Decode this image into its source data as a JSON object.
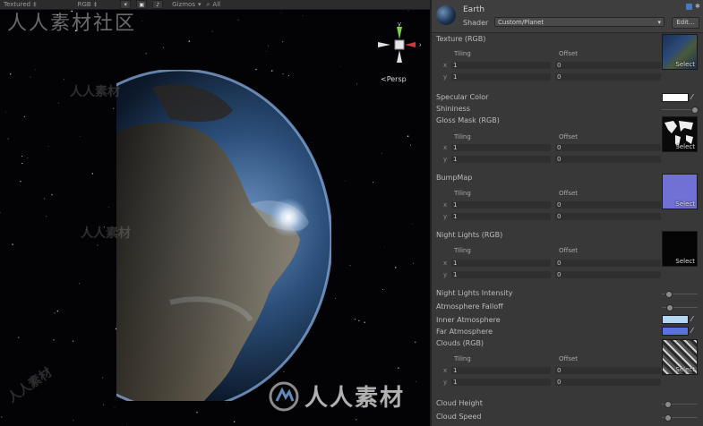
{
  "toolbar": {
    "draw_mode": "Textured",
    "render_mode": "RGB",
    "gizmos": "Gizmos",
    "search": "All"
  },
  "scene": {
    "watermark_top": "人人素材社区",
    "logo_text": "人人素材",
    "side_watermark": "人人素材",
    "persp_label": "Persp",
    "gizmo_axes": {
      "x": "x",
      "y": "y"
    }
  },
  "inspector": {
    "material_name": "Earth",
    "shader_label": "Shader",
    "shader_value": "Custom/Planet",
    "edit_button": "Edit...",
    "tiling_header": "Tiling",
    "offset_header": "Offset",
    "select_label": "Select",
    "axis_x": "x",
    "axis_y": "y",
    "texture": {
      "label": "Texture (RGB)",
      "tx": "1",
      "ty": "1",
      "ox": "0",
      "oy": "0"
    },
    "specular_color": {
      "label": "Specular Color",
      "color": "#ffffff"
    },
    "shininess": {
      "label": "Shininess",
      "value": 0.98
    },
    "gloss_mask": {
      "label": "Gloss Mask (RGB)",
      "tx": "1",
      "ty": "1",
      "ox": "0",
      "oy": "0"
    },
    "bump_map": {
      "label": "BumpMap",
      "tx": "1",
      "ty": "1",
      "ox": "0",
      "oy": "0"
    },
    "night_lights": {
      "label": "Night Lights (RGB)",
      "tx": "1",
      "ty": "1",
      "ox": "0",
      "oy": "0"
    },
    "night_lights_intensity": {
      "label": "Night Lights Intensity",
      "value": 0.12
    },
    "atmosphere_falloff": {
      "label": "Atmosphere Falloff",
      "value": 0.15
    },
    "inner_atmosphere": {
      "label": "Inner Atmosphere",
      "color": "#b4d6f2"
    },
    "far_atmosphere": {
      "label": "Far Atmosphere",
      "color": "#5a73e0"
    },
    "clouds": {
      "label": "Clouds (RGB)",
      "tx": "1",
      "ty": "1",
      "ox": "0",
      "oy": "0"
    },
    "cloud_height": {
      "label": "Cloud Height",
      "value": 0.1
    },
    "cloud_speed": {
      "label": "Cloud Speed",
      "value": 0.1
    }
  }
}
